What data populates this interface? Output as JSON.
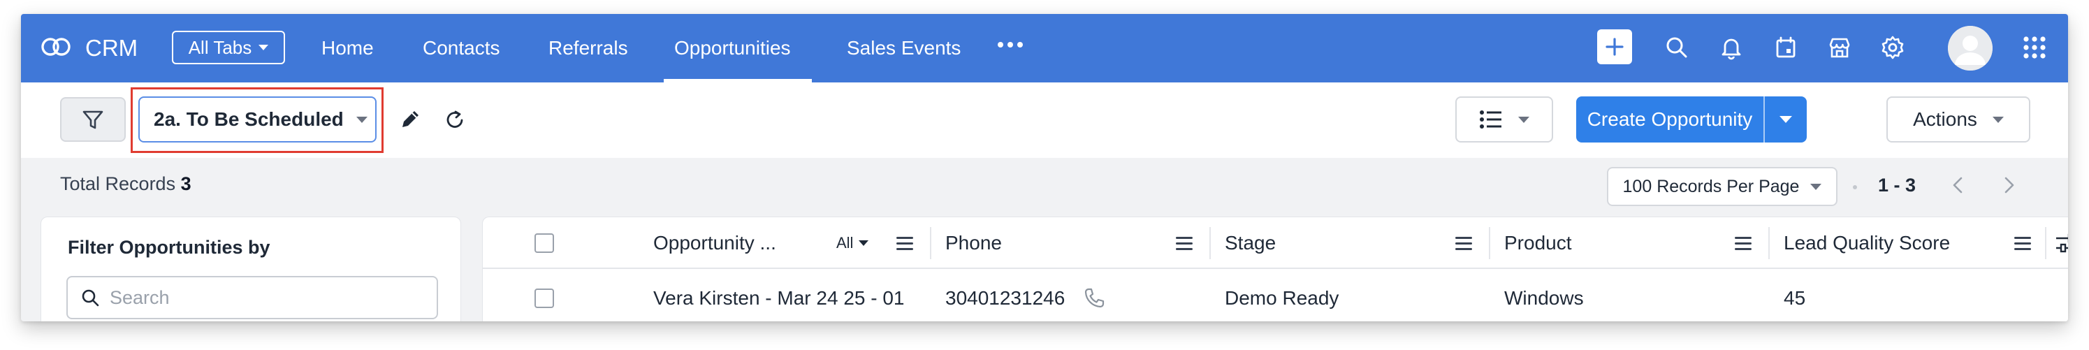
{
  "app": {
    "name": "CRM",
    "all_tabs_label": "All Tabs",
    "accent_color": "#4078d8"
  },
  "nav": {
    "tabs": [
      {
        "label": "Home",
        "active": false
      },
      {
        "label": "Contacts",
        "active": false
      },
      {
        "label": "Referrals",
        "active": false
      },
      {
        "label": "Opportunities",
        "active": true
      },
      {
        "label": "Sales Events",
        "active": false
      }
    ],
    "more_icon": "more-horizontal-icon",
    "icons": [
      "plus-icon",
      "search-icon",
      "bell-icon",
      "calendar-icon",
      "marketplace-icon",
      "gear-icon",
      "avatar",
      "apps-grid-icon"
    ]
  },
  "toolbar": {
    "view_label": "2a. To Be Scheduled",
    "create_label": "Create Opportunity",
    "actions_label": "Actions"
  },
  "records": {
    "total_label": "Total Records",
    "total_count": "3",
    "per_page_label": "100 Records Per Page",
    "range": "1 - 3"
  },
  "filter_panel": {
    "title": "Filter Opportunities by",
    "search_placeholder": "Search"
  },
  "table": {
    "columns": [
      {
        "label": "Opportunity ...",
        "filter": "All"
      },
      {
        "label": "Phone"
      },
      {
        "label": "Stage"
      },
      {
        "label": "Product"
      },
      {
        "label": "Lead Quality Score"
      }
    ],
    "rows": [
      {
        "opportunity": "Vera Kirsten - Mar 24 25 - 01",
        "phone": "30401231246",
        "stage": "Demo Ready",
        "product": "Windows",
        "lead_quality_score": "45"
      }
    ]
  }
}
